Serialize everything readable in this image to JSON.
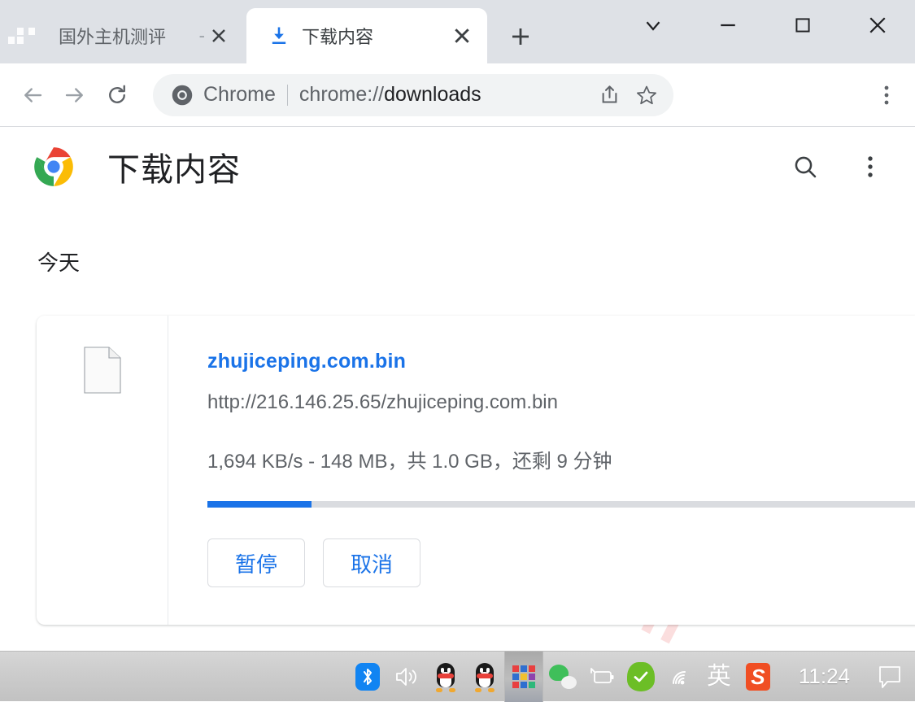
{
  "window": {
    "controls": [
      {
        "name": "tab-search-chevron",
        "glyph": "chevron-down"
      },
      {
        "name": "minimize",
        "glyph": "minus"
      },
      {
        "name": "maximize",
        "glyph": "square"
      },
      {
        "name": "close",
        "glyph": "x"
      }
    ]
  },
  "tabs": [
    {
      "title": "国外主机测评",
      "truncated_suffix": "-",
      "favicon": "red-site-favicon",
      "active": false,
      "close_label": "×"
    },
    {
      "title": "下载内容",
      "favicon": "download-arrow-icon",
      "active": true,
      "close_label": "×"
    }
  ],
  "newtab": {
    "label": "+",
    "name": "new-tab-button"
  },
  "toolbar": {
    "back": "back-arrow-icon",
    "forward": "forward-arrow-icon",
    "reload": "reload-icon",
    "omnibox": {
      "badge": "chrome-logo-icon",
      "label": "Chrome",
      "url_scheme": "chrome://",
      "url_path": "downloads",
      "full_url": "chrome://downloads"
    },
    "share": "share-icon",
    "bookmark": "star-icon",
    "menu": "kebab-menu-icon"
  },
  "page": {
    "logo": "chrome-logo",
    "title": "下载内容",
    "search_label": "search-icon",
    "menu_label": "kebab-menu-icon",
    "watermark": "zhujiceping.com",
    "section_label": "今天",
    "download": {
      "file_icon": "generic-file-icon",
      "filename": "zhujiceping.com.bin",
      "url": "http://216.146.25.65/zhujiceping.com.bin",
      "status": "1,694 KB/s - 148 MB，共 1.0 GB，还剩 9 分钟",
      "speed": "1,694 KB/s",
      "downloaded": "148 MB",
      "total": "1.0 GB",
      "remaining": "还剩 9 分钟",
      "progress_percent": 14.5,
      "accent_color": "#1a73e8",
      "track_color": "#dadce0",
      "buttons": [
        {
          "label": "暂停",
          "name": "pause-download-button"
        },
        {
          "label": "取消",
          "name": "cancel-download-button"
        }
      ]
    }
  },
  "taskbar": {
    "clock": "11:24",
    "items": [
      {
        "name": "bluetooth-icon"
      },
      {
        "name": "volume-icon"
      },
      {
        "name": "qq-icon"
      },
      {
        "name": "qq-icon-2"
      },
      {
        "name": "app-grid-icon"
      },
      {
        "name": "wechat-icon"
      },
      {
        "name": "battery-charging-icon"
      },
      {
        "name": "security-check-icon"
      },
      {
        "name": "wifi-icon"
      },
      {
        "name": "ime-english-icon",
        "label": "英"
      },
      {
        "name": "sogou-icon",
        "label": "S"
      }
    ],
    "notification": "notification-icon"
  }
}
